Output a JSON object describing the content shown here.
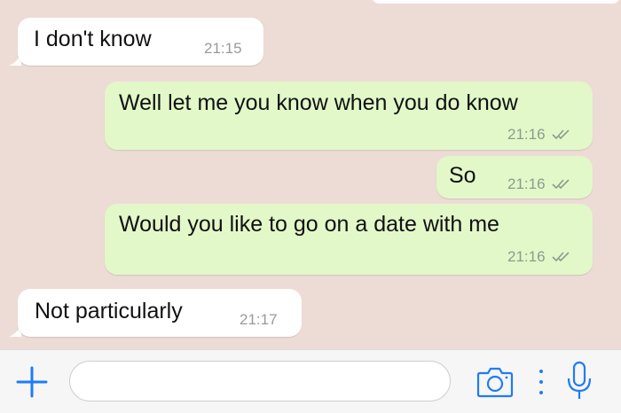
{
  "chat": {
    "messages": [
      {
        "direction": "incoming",
        "text": "I don't know",
        "time": "21:15"
      },
      {
        "direction": "outgoing",
        "text": "Well let me you know when you do know",
        "time": "21:16",
        "status": "read"
      },
      {
        "direction": "outgoing",
        "text": "So",
        "time": "21:16",
        "status": "read"
      },
      {
        "direction": "outgoing",
        "text": "Would you like to go on a date with me",
        "time": "21:16",
        "status": "read"
      },
      {
        "direction": "incoming",
        "text": "Not particularly",
        "time": "21:17"
      }
    ]
  },
  "input_bar": {
    "add_icon": "plus-icon",
    "message_value": "",
    "message_placeholder": "",
    "camera_icon": "camera-icon",
    "more_icon": "dots-icon",
    "mic_icon": "microphone-icon"
  },
  "colors": {
    "chat_background": "#eddcd5",
    "incoming_bubble": "#ffffff",
    "outgoing_bubble": "#e2f8c8",
    "accent": "#1f7cf6",
    "read_ticks": "#8e9a8e"
  }
}
